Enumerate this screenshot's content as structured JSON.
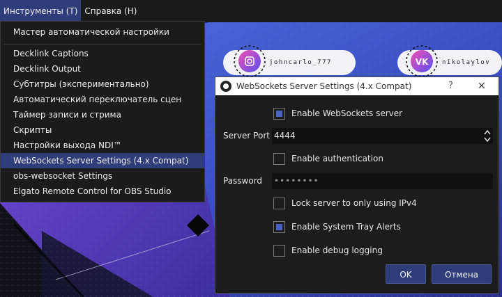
{
  "menubar": {
    "tools": "Инструменты (T)",
    "help": "Справка (H)"
  },
  "preview": {
    "instagram_handle": "johncarlo_777",
    "vk_handle": "nikolaylov"
  },
  "tools_menu": {
    "items": [
      "Мастер автоматической настройки",
      "Decklink Captions",
      "Decklink Output",
      "Субтитры (экспериментально)",
      "Автоматический переключатель сцен",
      "Таймер записи и стрима",
      "Скрипты",
      "Настройки выхода NDI™",
      "WebSockets Server Settings (4.x Compat)",
      "obs-websocket Settings",
      "Elgato Remote Control for OBS Studio"
    ],
    "selected_index": 8
  },
  "dialog": {
    "title": "WebSockets Server Settings (4.x Compat)",
    "help_label": "?",
    "close_label": "✕",
    "enable_server_label": "Enable WebSockets server",
    "enable_server_checked": true,
    "server_port_label": "Server Port",
    "server_port_value": "4444",
    "enable_auth_label": "Enable authentication",
    "enable_auth_checked": false,
    "password_label": "Password",
    "password_value": "••••••••",
    "ipv4_label": "Lock server to only using IPv4",
    "ipv4_checked": false,
    "tray_alerts_label": "Enable System Tray Alerts",
    "tray_alerts_checked": true,
    "debug_label": "Enable debug logging",
    "debug_checked": false,
    "ok_label": "OK",
    "cancel_label": "Отмена"
  },
  "colors": {
    "accent": "#2f3e7a",
    "checkbox_fill": "#4a62c6",
    "menu_bg": "#1b1b1c",
    "dialog_bg": "#1c1c1c",
    "preview_blue": "#3a56c8",
    "preview_purple": "#8a3fd0"
  },
  "icons": {
    "obs": "obs-logo-icon",
    "instagram": "instagram-icon",
    "vk": "vk-icon",
    "spinner": "spinner-arrows-icon"
  }
}
